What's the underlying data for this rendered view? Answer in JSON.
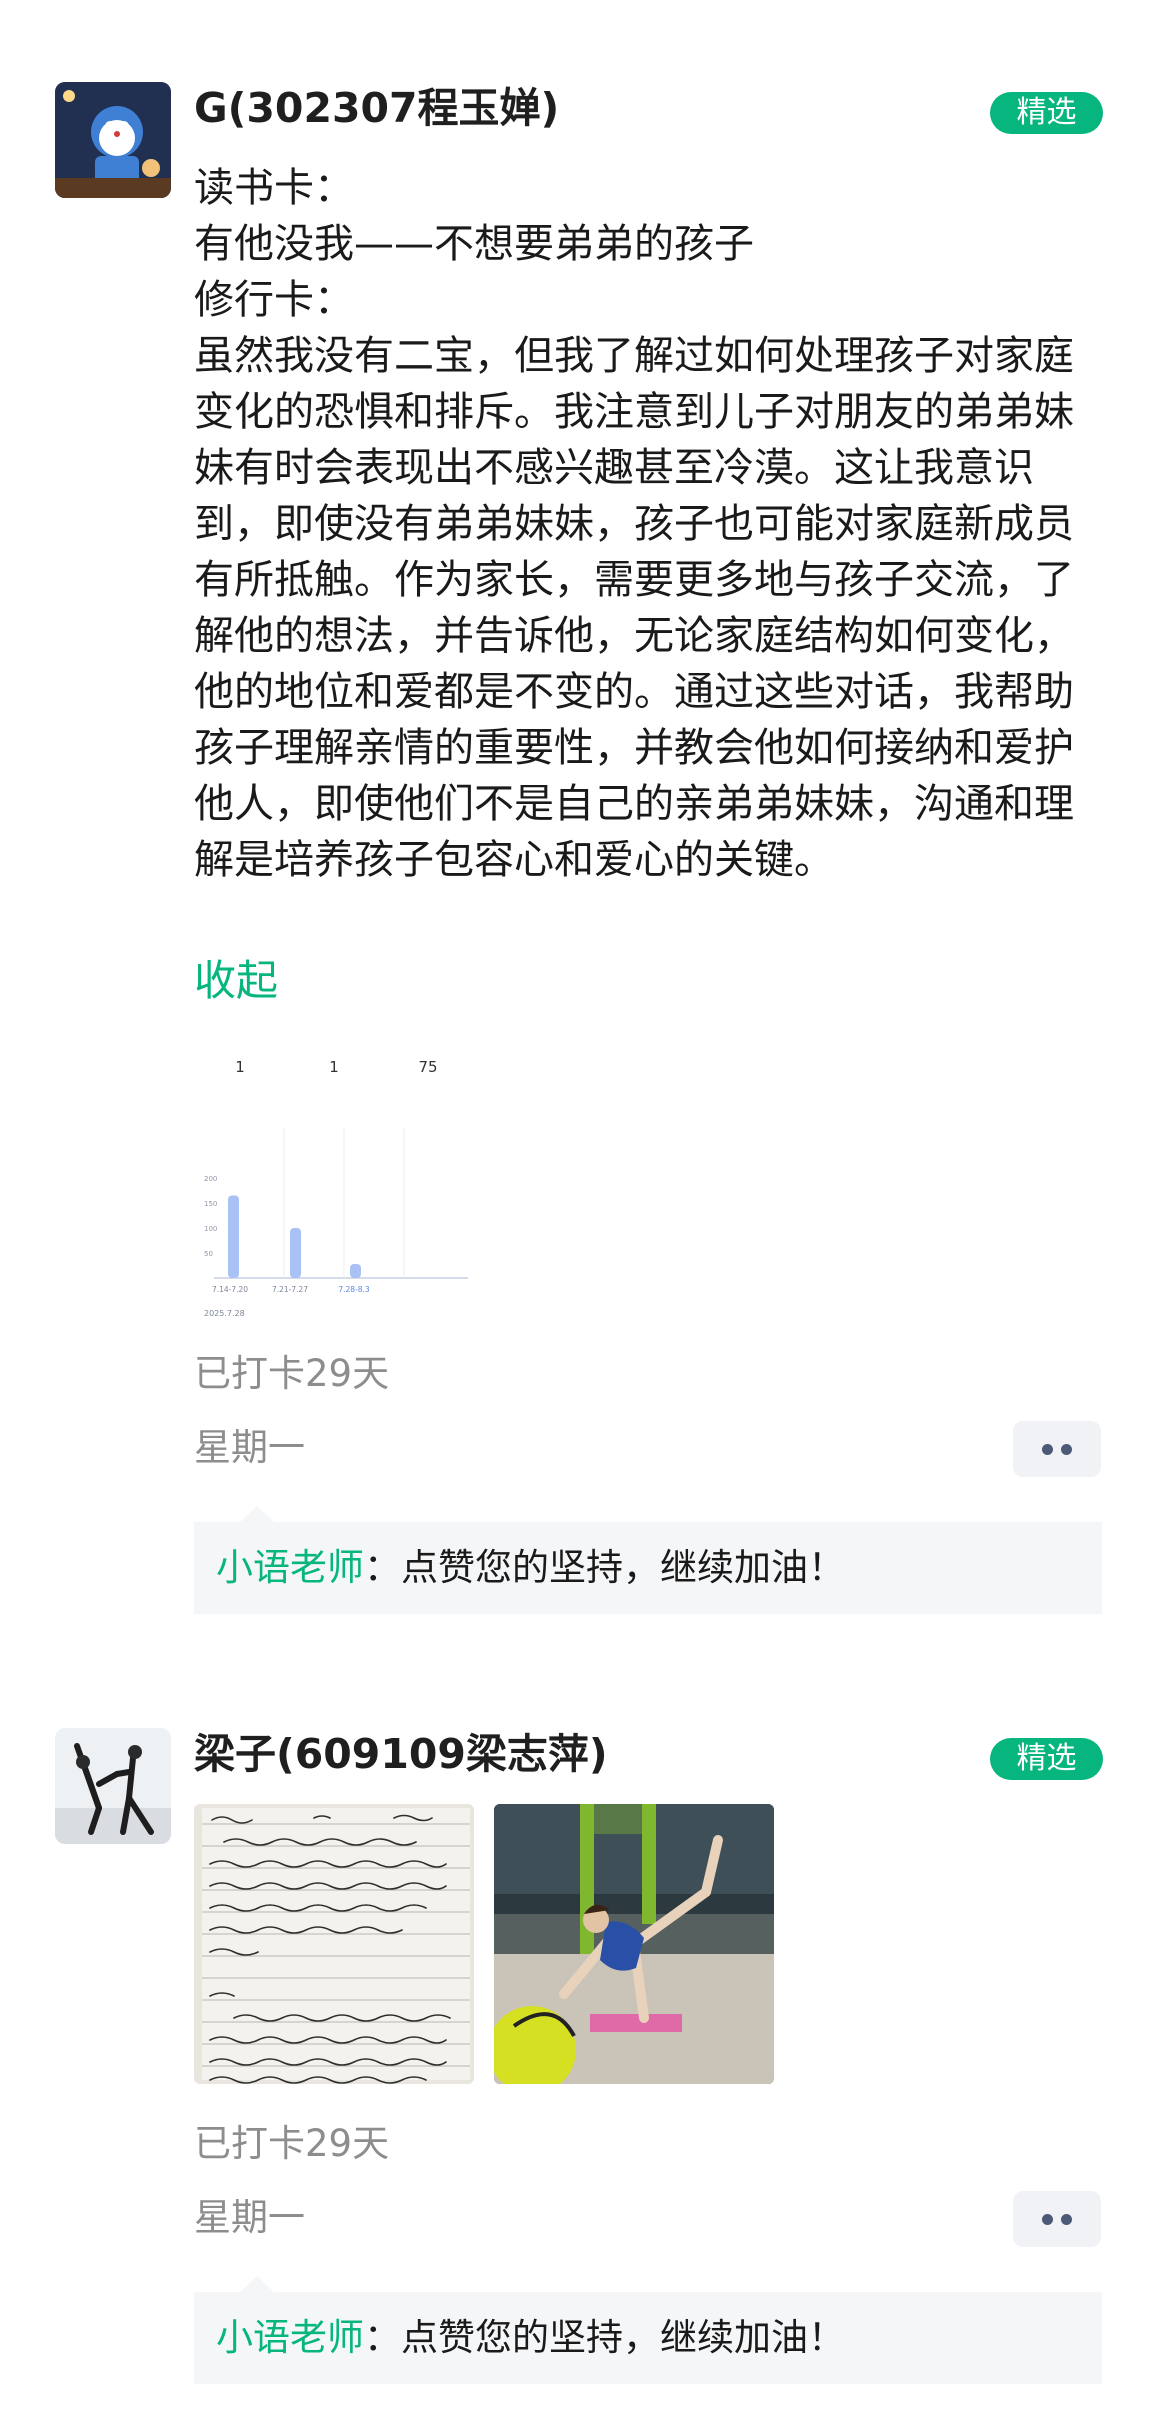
{
  "posts": [
    {
      "username": "G(302307程玉婵)",
      "badge": "精选",
      "content_lines": [
        "读书卡：",
        "有他没我——不想要弟弟的孩子",
        "修行卡：",
        "虽然我没有二宝，但我了解过如何处理孩子对家庭变化的恐惧和排斥。我注意到儿子对朋友的弟弟妹妹有时会表现出不感兴趣甚至冷漠。这让我意识到，即使没有弟弟妹妹，孩子也可能对家庭新成员有所抵触。作为家长，需要更多地与孩子交流，了解他的想法，并告诉他，无论家庭结构如何变化，他的地位和爱都是不变的。通过这些对话，我帮助孩子理解亲情的重要性，并教会他如何接纳和爱护他人，即使他们不是自己的亲弟弟妹妹，沟通和理解是培养孩子包容心和爱心的关键。"
      ],
      "collapse_label": "收起",
      "stats_image": {
        "stats": [
          {
            "value": "1"
          },
          {
            "value": "1"
          },
          {
            "value": "75"
          }
        ],
        "chart_data": {
          "type": "bar",
          "categories": [
            "7.14-7.20",
            "7.21-7.27",
            "7.28-8.3"
          ],
          "values": [
            165,
            100,
            28
          ],
          "ylim": [
            0,
            250
          ],
          "y_ticks": [
            "200",
            "150",
            "100",
            "50"
          ],
          "date": "2025.7.28",
          "color": "#a9c1f5"
        }
      },
      "checkin": "已打卡29天",
      "weekday": "星期一",
      "comment": {
        "author": "小语老师",
        "separator": "：",
        "text": "点赞您的坚持，继续加油！"
      }
    },
    {
      "username": "梁子(609109梁志萍)",
      "badge": "精选",
      "photos": [
        "handwritten-notes-photo",
        "yoga-pose-photo"
      ],
      "checkin": "已打卡29天",
      "weekday": "星期一",
      "comment": {
        "author": "小语老师",
        "separator": "：",
        "text": "点赞您的坚持，继续加油！"
      }
    }
  ],
  "colors": {
    "accent": "#07b57e",
    "muted_text": "#8d8d8d",
    "comment_bg": "#f5f6f8",
    "more_dots": "#4c5a78"
  }
}
